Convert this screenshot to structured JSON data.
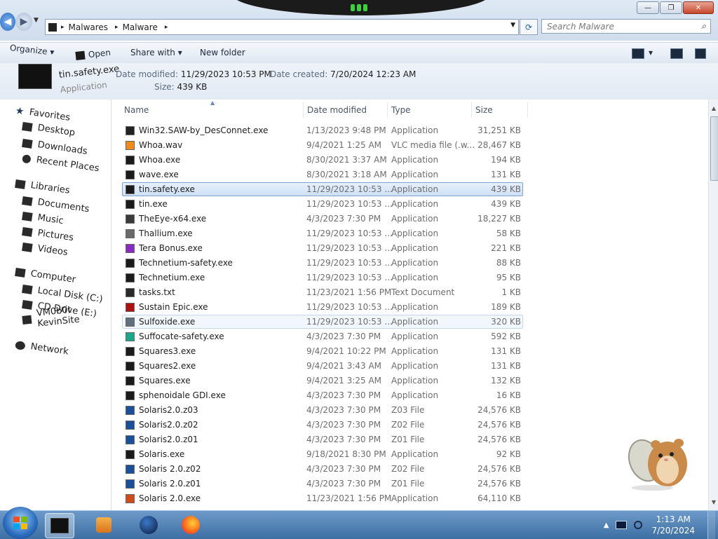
{
  "window": {
    "minimize_glyph": "—",
    "maximize_glyph": "❐",
    "close_glyph": "✕"
  },
  "navigation": {
    "back_glyph": "◀",
    "forward_glyph": "▶",
    "dropdown_glyph": "▼"
  },
  "address": {
    "crumbs": [
      "Malwares",
      "Malware"
    ],
    "separator": "▸",
    "dropdown_glyph": "▼"
  },
  "refresh_glyph": "⟳",
  "search": {
    "placeholder": "Search Malware",
    "icon_glyph": "⌕"
  },
  "toolbar": {
    "organize": "Organize",
    "organize_arrow": "▾",
    "open": "Open",
    "share_with": "Share with",
    "share_arrow": "▾",
    "new_folder": "New folder",
    "view_arrow": "▾"
  },
  "details_pane": {
    "name": "tin.safety.exe",
    "type": "Application",
    "date_modified_label": "Date modified:",
    "date_modified": "11/29/2023 10:53 PM",
    "date_created_label": "Date created:",
    "date_created": "7/20/2024 12:23 AM",
    "size_label": "Size:",
    "size": "439 KB"
  },
  "sidebar": {
    "favorites": "Favorites",
    "desktop": "Desktop",
    "downloads": "Downloads",
    "recent_places": "Recent Places",
    "libraries": "Libraries",
    "documents": "Documents",
    "music": "Music",
    "pictures": "Pictures",
    "videos": "Videos",
    "computer": "Computer",
    "local_disk": "Local Disk (C:)",
    "cd_drive": "CD Drive (E:)",
    "network_share": "VM0b0t KevinSite",
    "network": "Network"
  },
  "columns": {
    "name": "Name",
    "date_modified": "Date modified",
    "type": "Type",
    "size": "Size",
    "sort_glyph": "▲"
  },
  "files": [
    {
      "name": "Win32.SAW-by_DesConnet.exe",
      "date": "1/13/2023 9:48 PM",
      "type": "Application",
      "size": "31,251 KB"
    },
    {
      "name": "Whoa.wav",
      "date": "9/4/2021 1:25 AM",
      "type": "VLC media file (.w...",
      "size": "28,467 KB"
    },
    {
      "name": "Whoa.exe",
      "date": "8/30/2021 3:37 AM",
      "type": "Application",
      "size": "194 KB"
    },
    {
      "name": "wave.exe",
      "date": "8/30/2021 3:18 AM",
      "type": "Application",
      "size": "131 KB"
    },
    {
      "name": "tin.safety.exe",
      "date": "11/29/2023 10:53 ...",
      "type": "Application",
      "size": "439 KB"
    },
    {
      "name": "tin.exe",
      "date": "11/29/2023 10:53 ...",
      "type": "Application",
      "size": "439 KB"
    },
    {
      "name": "TheEye-x64.exe",
      "date": "4/3/2023 7:30 PM",
      "type": "Application",
      "size": "18,227 KB"
    },
    {
      "name": "Thallium.exe",
      "date": "11/29/2023 10:53 ...",
      "type": "Application",
      "size": "58 KB"
    },
    {
      "name": "Tera Bonus.exe",
      "date": "11/29/2023 10:53 ...",
      "type": "Application",
      "size": "221 KB"
    },
    {
      "name": "Technetium-safety.exe",
      "date": "11/29/2023 10:53 ...",
      "type": "Application",
      "size": "88 KB"
    },
    {
      "name": "Technetium.exe",
      "date": "11/29/2023 10:53 ...",
      "type": "Application",
      "size": "95 KB"
    },
    {
      "name": "tasks.txt",
      "date": "11/23/2021 1:56 PM",
      "type": "Text Document",
      "size": "1 KB"
    },
    {
      "name": "Sustain Epic.exe",
      "date": "11/29/2023 10:53 ...",
      "type": "Application",
      "size": "189 KB"
    },
    {
      "name": "Sulfoxide.exe",
      "date": "11/29/2023 10:53 ...",
      "type": "Application",
      "size": "320 KB"
    },
    {
      "name": "Suffocate-safety.exe",
      "date": "4/3/2023 7:30 PM",
      "type": "Application",
      "size": "592 KB"
    },
    {
      "name": "Squares3.exe",
      "date": "9/4/2021 10:22 PM",
      "type": "Application",
      "size": "131 KB"
    },
    {
      "name": "Squares2.exe",
      "date": "9/4/2021 3:43 AM",
      "type": "Application",
      "size": "131 KB"
    },
    {
      "name": "Squares.exe",
      "date": "9/4/2021 3:25 AM",
      "type": "Application",
      "size": "132 KB"
    },
    {
      "name": "sphenoidale GDI.exe",
      "date": "4/3/2023 7:30 PM",
      "type": "Application",
      "size": "16 KB"
    },
    {
      "name": "Solaris2.0.z03",
      "date": "4/3/2023 7:30 PM",
      "type": "Z03 File",
      "size": "24,576 KB"
    },
    {
      "name": "Solaris2.0.z02",
      "date": "4/3/2023 7:30 PM",
      "type": "Z02 File",
      "size": "24,576 KB"
    },
    {
      "name": "Solaris2.0.z01",
      "date": "4/3/2023 7:30 PM",
      "type": "Z01 File",
      "size": "24,576 KB"
    },
    {
      "name": "Solaris.exe",
      "date": "9/18/2021 8:30 PM",
      "type": "Application",
      "size": "92 KB"
    },
    {
      "name": "Solaris 2.0.z02",
      "date": "4/3/2023 7:30 PM",
      "type": "Z02 File",
      "size": "24,576 KB"
    },
    {
      "name": "Solaris 2.0.z01",
      "date": "4/3/2023 7:30 PM",
      "type": "Z01 File",
      "size": "24,576 KB"
    },
    {
      "name": "Solaris 2.0.exe",
      "date": "11/23/2021 1:56 PM",
      "type": "Application",
      "size": "64,110 KB"
    }
  ],
  "file_icon_colors": [
    "#222222",
    "#f08a1c",
    "#1b1b1b",
    "#1b1b1b",
    "#1b1b1b",
    "#1b1b1b",
    "#3a3a3a",
    "#6a6a6a",
    "#8a2bbf",
    "#1b1b1b",
    "#1b1b1b",
    "#2a2a2a",
    "#b01010",
    "#607080",
    "#1aa88a",
    "#1b1b1b",
    "#1b1b1b",
    "#1b1b1b",
    "#1b1b1b",
    "#1a4f9a",
    "#1a4f9a",
    "#1a4f9a",
    "#1b1b1b",
    "#1a4f9a",
    "#1a4f9a",
    "#d04a1a"
  ],
  "selected_row": 4,
  "hovered_row": 13,
  "scrollbar": {
    "up_glyph": "▲",
    "down_glyph": "▼"
  },
  "taskbar": {
    "time": "1:13 AM",
    "date": "7/20/2024",
    "tray_up_glyph": "▲"
  }
}
